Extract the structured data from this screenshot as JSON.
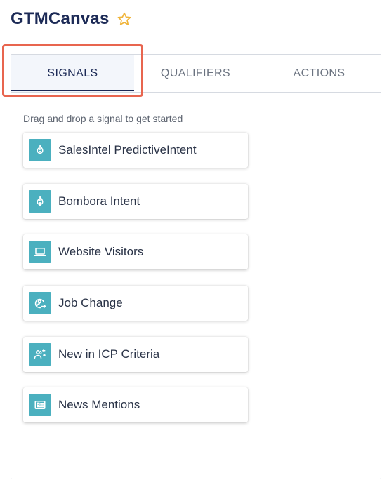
{
  "header": {
    "title": "GTMCanvas",
    "favorite_icon": "star-outline-icon",
    "star_color": "#f0b43a"
  },
  "tabs": [
    {
      "label": "SIGNALS",
      "active": true
    },
    {
      "label": "QUALIFIERS",
      "active": false
    },
    {
      "label": "ACTIONS",
      "active": false
    }
  ],
  "signals_panel": {
    "hint": "Drag and drop a signal to get started",
    "icon_color": "#4bb0bf",
    "items": [
      {
        "label": "SalesIntel PredictiveIntent",
        "icon": "flame-icon"
      },
      {
        "label": "Bombora Intent",
        "icon": "flame-icon"
      },
      {
        "label": "Website Visitors",
        "icon": "laptop-icon"
      },
      {
        "label": "Job Change",
        "icon": "person-transfer-icon"
      },
      {
        "label": "New in ICP Criteria",
        "icon": "people-sparkle-icon"
      },
      {
        "label": "News Mentions",
        "icon": "newspaper-icon"
      }
    ]
  },
  "annotation": {
    "highlight_color": "#e8654f",
    "target": "SIGNALS"
  }
}
